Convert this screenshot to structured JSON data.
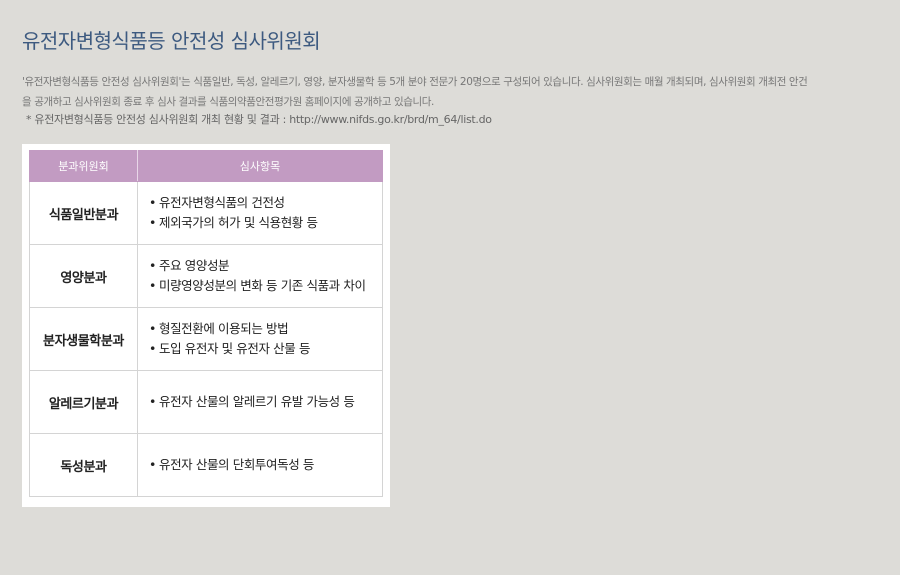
{
  "page": {
    "title": "유전자변형식품등 안전성 심사위원회",
    "intro_line1": "'유전자변형식품등 안전성 심사위원회'는 식품일반, 독성, 알레르기, 영양, 분자생물학 등 5개 분야 전문가 20명으로 구성되어 있습니다. 심사위원회는 매월 개최되며, 심사위원회 개최전 안건",
    "intro_line2": "을 공개하고 심사위원회 종료 후 심사 결과를 식품의약품안전평가원 홈페이지에 공개하고 있습니다.",
    "note": "* 유전자변형식품등 안전성 심사위원회 개최 현황 및 결과 : http://www.nifds.go.kr/brd/m_64/list.do"
  },
  "table": {
    "headers": [
      "분과위원회",
      "심사항목"
    ],
    "rows": [
      {
        "committee": "식품일반분과",
        "items": [
          "유전자변형식품의 건전성",
          "제외국가의 허가 및 식용현황 등"
        ]
      },
      {
        "committee": "영양분과",
        "items": [
          "주요 영양성분",
          "미량영양성분의 변화 등 기존 식품과 차이"
        ]
      },
      {
        "committee": "분자생물학분과",
        "items": [
          "형질전환에 이용되는 방법",
          "도입 유전자 및 유전자 산물 등"
        ]
      },
      {
        "committee": "알레르기분과",
        "items": [
          "유전자 산물의 알레르기 유발 가능성 등"
        ]
      },
      {
        "committee": "독성분과",
        "items": [
          "유전자 산물의 단회투여독성 등"
        ]
      }
    ]
  },
  "colors": {
    "title": "#3d5a80",
    "header_bg": "#c29bc2",
    "page_bg": "#dddcd8"
  }
}
